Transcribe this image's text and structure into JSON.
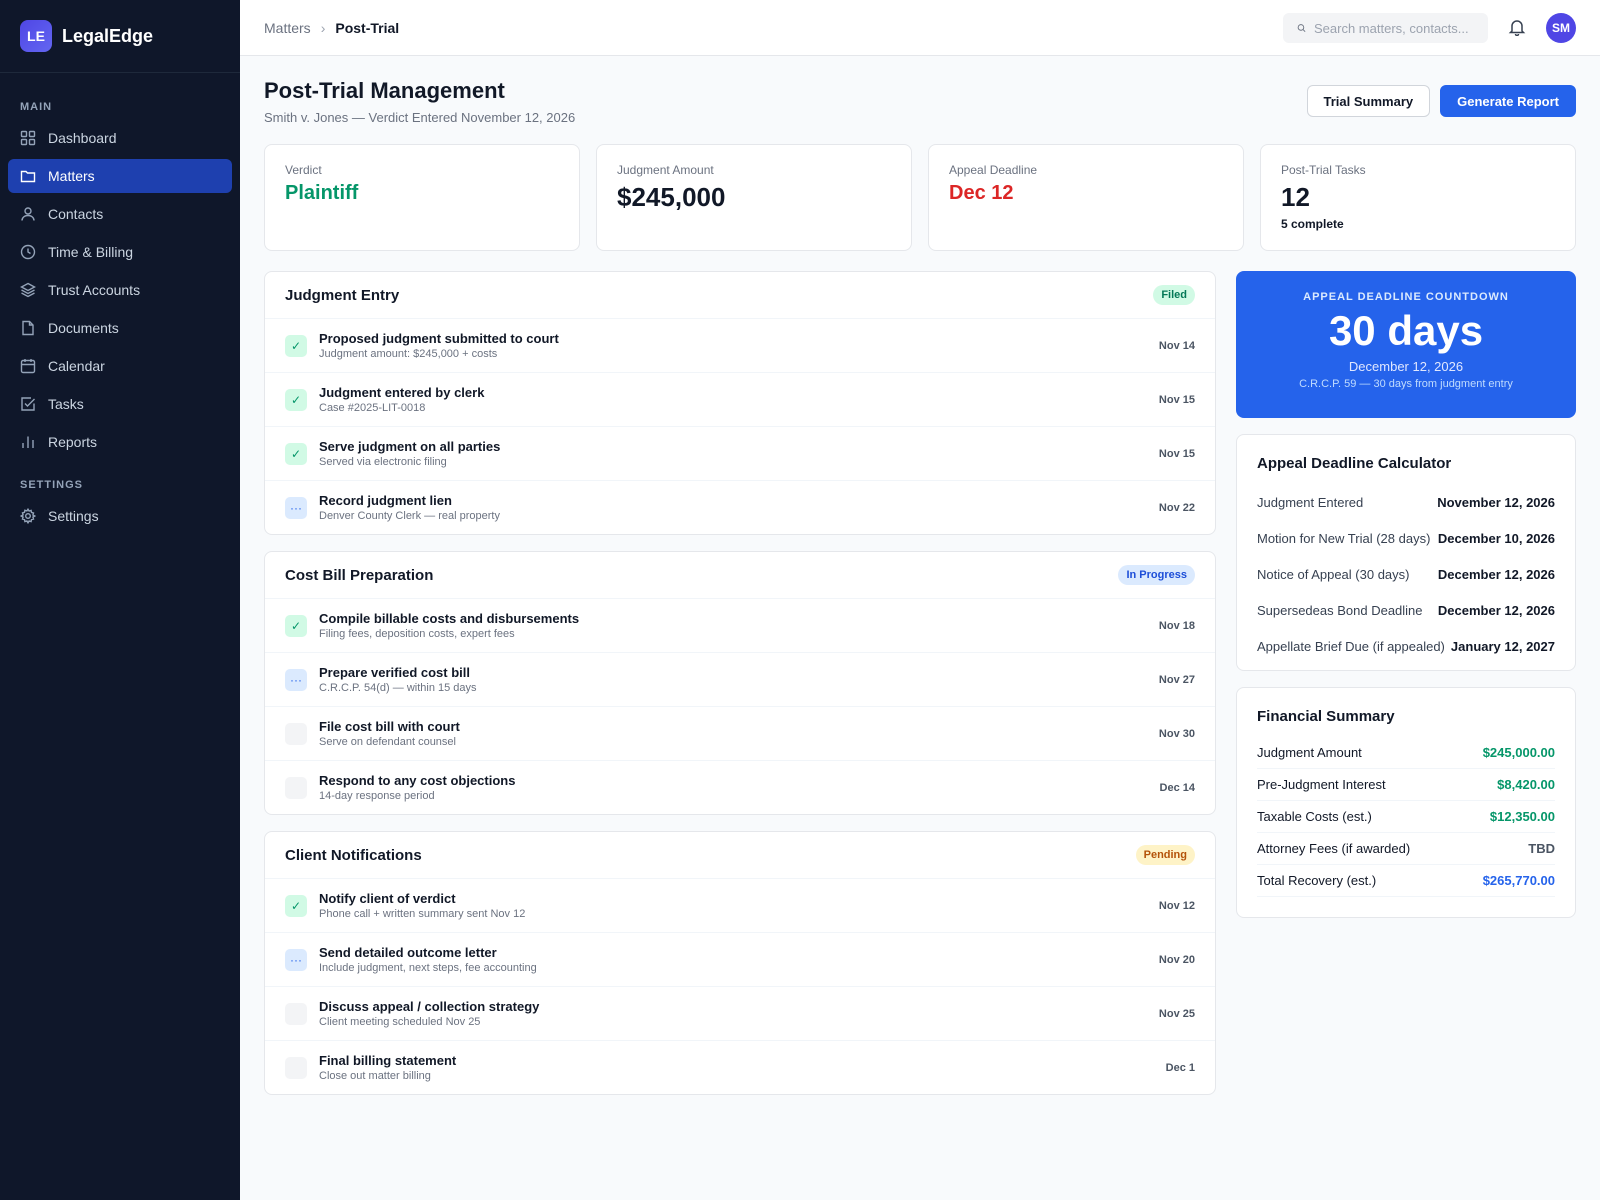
{
  "app": {
    "logo_initials": "LE",
    "name": "LegalEdge"
  },
  "sidebar": {
    "main_label": "MAIN",
    "settings_label": "SETTINGS",
    "items": [
      {
        "label": "Dashboard",
        "icon": "grid-icon"
      },
      {
        "label": "Matters",
        "icon": "folder-icon",
        "active": true
      },
      {
        "label": "Contacts",
        "icon": "user-icon"
      },
      {
        "label": "Time & Billing",
        "icon": "clock-icon"
      },
      {
        "label": "Trust Accounts",
        "icon": "layers-icon"
      },
      {
        "label": "Documents",
        "icon": "document-icon"
      },
      {
        "label": "Calendar",
        "icon": "calendar-icon"
      },
      {
        "label": "Tasks",
        "icon": "checkbox-icon"
      },
      {
        "label": "Reports",
        "icon": "bar-chart-icon"
      }
    ],
    "settings_items": [
      {
        "label": "Settings",
        "icon": "gear-icon"
      }
    ]
  },
  "topbar": {
    "breadcrumb": [
      "Matters",
      "Post-Trial"
    ],
    "search_placeholder": "Search matters, contacts...",
    "avatar_initials": "SM"
  },
  "header": {
    "title": "Post-Trial Management",
    "subtitle": "Smith v. Jones — Verdict Entered November 12, 2026",
    "secondary_button": "Trial Summary",
    "primary_button": "Generate Report"
  },
  "stats": [
    {
      "label": "Verdict",
      "value": "Plaintiff",
      "color": "#059669"
    },
    {
      "label": "Judgment Amount",
      "value": "$245,000"
    },
    {
      "label": "Appeal Deadline",
      "value": "Dec 12",
      "color": "#dc2626"
    },
    {
      "label": "Post-Trial Tasks",
      "value": "12",
      "note": "5 complete"
    }
  ],
  "sections": [
    {
      "title": "Judgment Entry",
      "badge": "Filed",
      "tasks": [
        {
          "title": "Proposed judgment submitted to court",
          "sub": "Judgment amount: $245,000 + costs",
          "date": "Nov 14",
          "status": "done"
        },
        {
          "title": "Judgment entered by clerk",
          "sub": "Case #2025-LIT-0018",
          "date": "Nov 15",
          "status": "done"
        },
        {
          "title": "Serve judgment on all parties",
          "sub": "Served via electronic filing",
          "date": "Nov 15",
          "status": "done"
        },
        {
          "title": "Record judgment lien",
          "sub": "Denver County Clerk — real property",
          "date": "Nov 22",
          "status": "in-progress"
        }
      ]
    },
    {
      "title": "Cost Bill Preparation",
      "badge": "In Progress",
      "tasks": [
        {
          "title": "Compile billable costs and disbursements",
          "sub": "Filing fees, deposition costs, expert fees",
          "date": "Nov 18",
          "status": "done"
        },
        {
          "title": "Prepare verified cost bill",
          "sub": "C.R.C.P. 54(d) — within 15 days",
          "date": "Nov 27",
          "status": "in-progress"
        },
        {
          "title": "File cost bill with court",
          "sub": "Serve on defendant counsel",
          "date": "Nov 30",
          "status": "todo"
        },
        {
          "title": "Respond to any cost objections",
          "sub": "14-day response period",
          "date": "Dec 14",
          "status": "todo"
        }
      ]
    },
    {
      "title": "Client Notifications",
      "badge": "Pending",
      "tasks": [
        {
          "title": "Notify client of verdict",
          "sub": "Phone call + written summary sent Nov 12",
          "date": "Nov 12",
          "status": "done"
        },
        {
          "title": "Send detailed outcome letter",
          "sub": "Include judgment, next steps, fee accounting",
          "date": "Nov 20",
          "status": "in-progress"
        },
        {
          "title": "Discuss appeal / collection strategy",
          "sub": "Client meeting scheduled Nov 25",
          "date": "Nov 25",
          "status": "todo"
        },
        {
          "title": "Final billing statement",
          "sub": "Close out matter billing",
          "date": "Dec 1",
          "status": "todo"
        }
      ]
    }
  ],
  "countdown": {
    "label": "APPEAL DEADLINE COUNTDOWN",
    "value": "30 days",
    "date": "December 12, 2026",
    "note": "C.R.C.P. 59 — 30 days from judgment entry"
  },
  "calculator": {
    "title": "Appeal Deadline Calculator",
    "rows": [
      {
        "label": "Judgment Entered",
        "value": "November 12, 2026"
      },
      {
        "label": "Motion for New Trial (28 days)",
        "value": "December 10, 2026"
      },
      {
        "label": "Notice of Appeal (30 days)",
        "value": "December 12, 2026"
      },
      {
        "label": "Supersedeas Bond Deadline",
        "value": "December 12, 2026"
      },
      {
        "label": "Appellate Brief Due (if appealed)",
        "value": "January 12, 2027"
      }
    ]
  },
  "financial": {
    "title": "Financial Summary",
    "rows": [
      {
        "label": "Judgment Amount",
        "value": "$245,000.00"
      },
      {
        "label": "Pre-Judgment Interest",
        "value": "$8,420.00"
      },
      {
        "label": "Taxable Costs (est.)",
        "value": "$12,350.00"
      },
      {
        "label": "Attorney Fees (if awarded)",
        "value": "TBD"
      },
      {
        "label": "Total Recovery (est.)",
        "value": "$265,770.00"
      }
    ]
  }
}
